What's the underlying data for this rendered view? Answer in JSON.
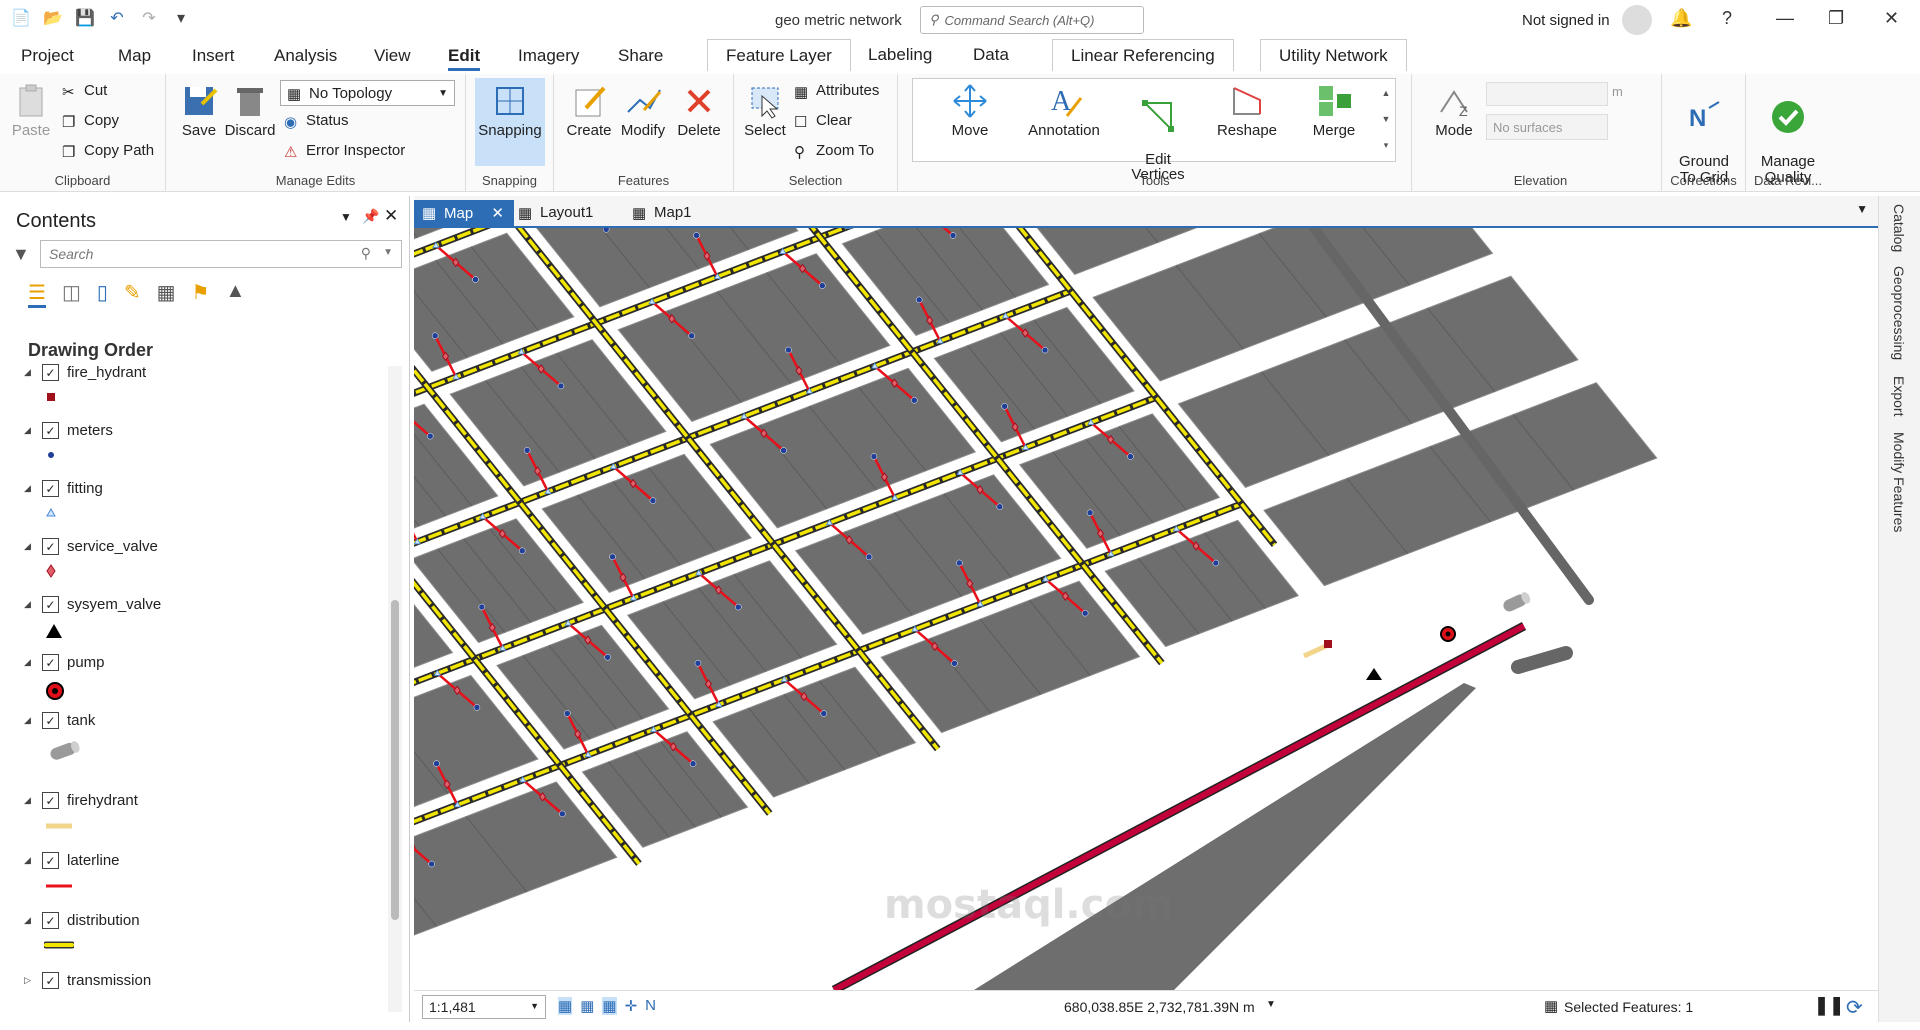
{
  "title_bar": {
    "doc_title": "geo metric network",
    "command_search_placeholder": "Command Search (Alt+Q)",
    "signed_status": "Not signed in"
  },
  "menu": [
    "Project",
    "Map",
    "Insert",
    "Analysis",
    "View",
    "Edit",
    "Imagery",
    "Share"
  ],
  "active_menu": "Edit",
  "context_tabs": [
    "Feature Layer",
    "Labeling",
    "Data",
    "Linear Referencing",
    "Utility Network"
  ],
  "ribbon": {
    "clipboard": {
      "label": "Clipboard",
      "paste": "Paste",
      "cut": "Cut",
      "copy": "Copy",
      "copy_path": "Copy Path"
    },
    "manage_edits": {
      "label": "Manage Edits",
      "save": "Save",
      "discard": "Discard",
      "topology": "No Topology",
      "status": "Status",
      "error_inspector": "Error Inspector"
    },
    "snapping": {
      "label": "Snapping",
      "button": "Snapping"
    },
    "features": {
      "label": "Features",
      "create": "Create",
      "modify": "Modify",
      "delete": "Delete"
    },
    "selection": {
      "label": "Selection",
      "select": "Select",
      "attributes": "Attributes",
      "clear": "Clear",
      "zoom_to": "Zoom To"
    },
    "tools": {
      "label": "Tools",
      "move": "Move",
      "annotation": "Annotation",
      "edit_vertices": "Edit\nVertices",
      "reshape": "Reshape",
      "merge": "Merge"
    },
    "elevation": {
      "label": "Elevation",
      "mode": "Mode",
      "unit": "m",
      "surfaces": "No surfaces"
    },
    "corrections": {
      "label": "Corrections",
      "ground_to_grid": "Ground\nTo Grid"
    },
    "data_reviewer": {
      "label": "Data Revi...",
      "manage_quality": "Manage\nQuality"
    }
  },
  "contents": {
    "title": "Contents",
    "search_placeholder": "Search",
    "drawing_order": "Drawing Order",
    "layers": [
      {
        "name": "fire_hydrant",
        "symbol": "dark-red-square"
      },
      {
        "name": "meters",
        "symbol": "blue-dot"
      },
      {
        "name": "fitting",
        "symbol": "small-blue-triangle"
      },
      {
        "name": "service_valve",
        "symbol": "red-diamond"
      },
      {
        "name": "sysyem_valve",
        "symbol": "black-triangle"
      },
      {
        "name": "pump",
        "symbol": "red-circle"
      },
      {
        "name": "tank",
        "symbol": "grey-cylinder"
      },
      {
        "name": "firehydrant",
        "symbol": "tan-line"
      },
      {
        "name": "laterline",
        "symbol": "red-line"
      },
      {
        "name": "distribution",
        "symbol": "yellow-line"
      },
      {
        "name": "transmission",
        "symbol": "crimson-line"
      }
    ]
  },
  "map_tabs": [
    "Map",
    "Layout1",
    "Map1"
  ],
  "active_map_tab": "Map",
  "status_bar": {
    "scale": "1:1,481",
    "coordinates": "680,038.85E 2,732,781.39N m",
    "selected_features": "Selected Features: 1"
  },
  "right_dock": [
    "Catalog",
    "Geoprocessing",
    "Export",
    "Modify Features"
  ],
  "watermark": "mostaql.com",
  "colors": {
    "accent": "#2d6db5",
    "block": "#6e6e6e",
    "distribution": "#f2e600",
    "laterline": "#e8101a",
    "transmission": "#c4003b",
    "meter": "#1f3f99"
  }
}
